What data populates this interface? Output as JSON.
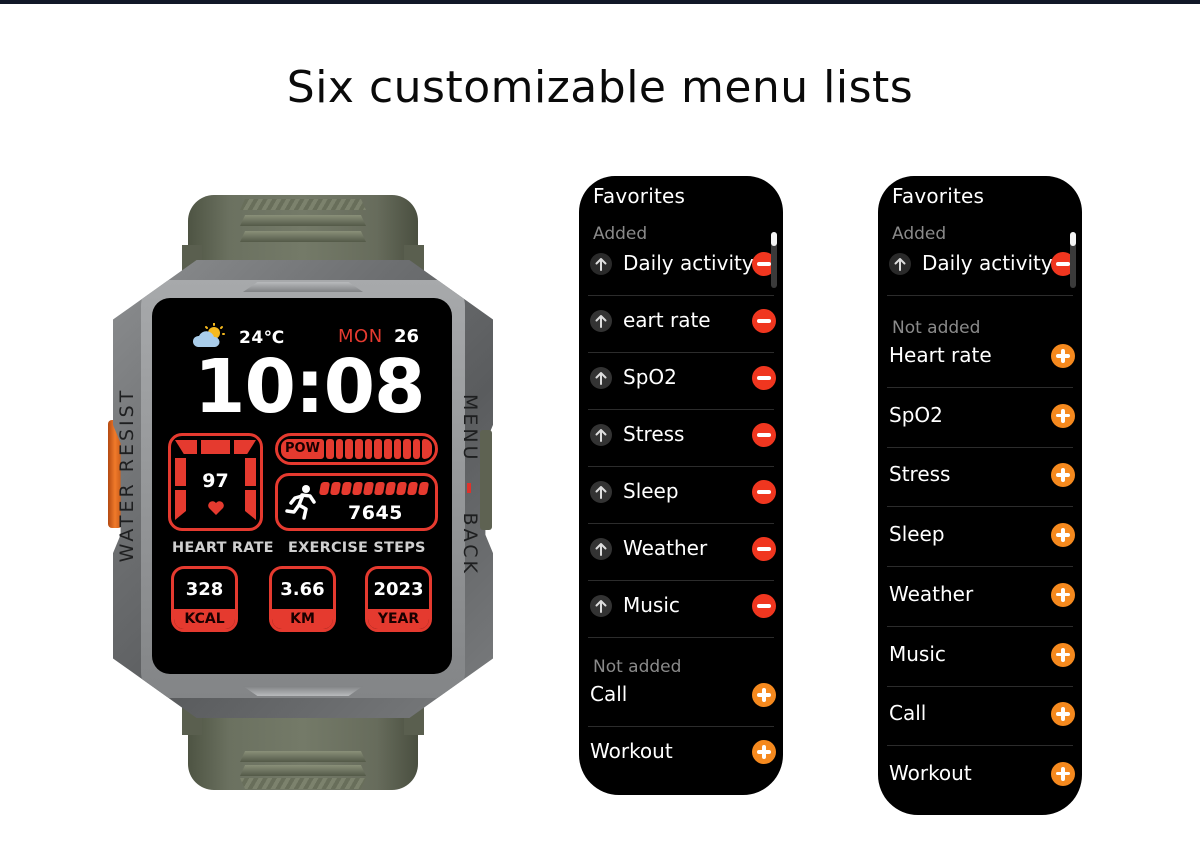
{
  "headline": "Six customizable menu lists",
  "watch": {
    "left_side_text": "WATER  RESIST",
    "right_side_text_a": "MENU",
    "right_side_text_b": "BACK",
    "screen": {
      "weather_icon": "partly-cloudy-icon",
      "temperature": "24℃",
      "day": "MON",
      "date": "26",
      "time": "10:08",
      "heart_rate_value": "97",
      "heart_rate_label": "HEART RATE",
      "power_label": "POW",
      "power_level_fraction": 1.0,
      "steps_value": "7645",
      "steps_label": "EXERCISE STEPS",
      "stats": [
        {
          "value": "328",
          "unit": "KCAL"
        },
        {
          "value": "3.66",
          "unit": "KM"
        },
        {
          "value": "2023",
          "unit": "YEAR"
        }
      ]
    },
    "colors": {
      "accent": "#e53a2f",
      "crown": "#f07a2a",
      "strap": "#6b7160"
    }
  },
  "panels": [
    {
      "title": "Favorites",
      "added_label": "Added",
      "added": [
        "Daily activity",
        "eart rate",
        "SpO2",
        "Stress",
        "Sleep",
        "Weather",
        "Music"
      ],
      "not_added_label": "Not added",
      "not_added": [
        "Call",
        "Workout"
      ]
    },
    {
      "title": "Favorites",
      "added_label": "Added",
      "added": [
        "Daily activity"
      ],
      "not_added_label": "Not added",
      "not_added": [
        "Heart rate",
        "SpO2",
        "Stress",
        "Sleep",
        "Weather",
        "Music",
        "Call",
        "Workout"
      ]
    }
  ],
  "icons": {
    "remove": "minus-circle-icon",
    "add": "plus-circle-icon",
    "reorder": "arrow-up-icon"
  },
  "colors": {
    "remove": "#f0361f",
    "add": "#f5891e",
    "panel_bg": "#000000",
    "section_label": "#8a8a8a"
  }
}
